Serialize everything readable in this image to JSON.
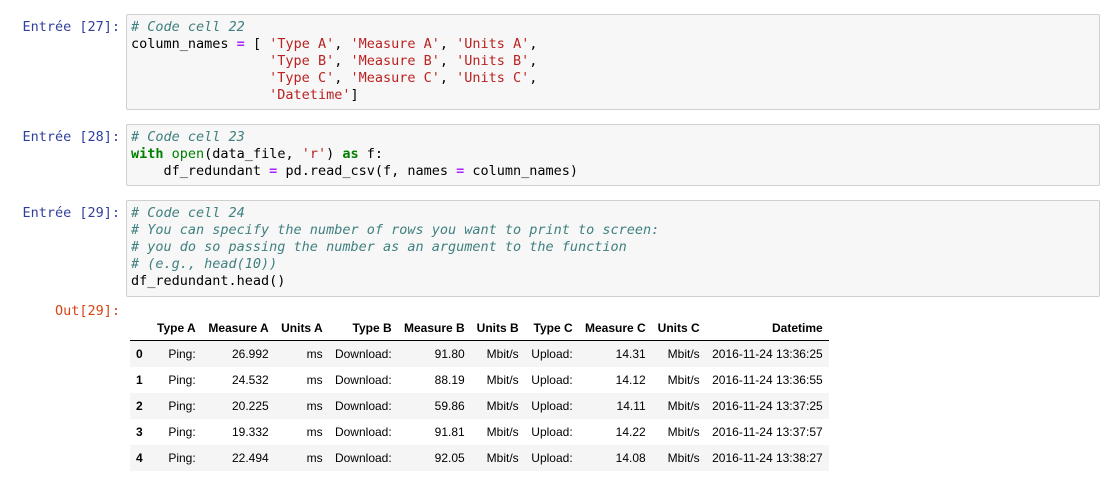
{
  "cells": [
    {
      "prompt": "Entrée [27]:",
      "lines": [
        [
          {
            "t": "# Code cell 22",
            "c": "comment"
          }
        ],
        [
          {
            "t": "column_names ",
            "c": ""
          },
          {
            "t": "=",
            "c": "op"
          },
          {
            "t": " [ ",
            "c": ""
          },
          {
            "t": "'Type A'",
            "c": "str"
          },
          {
            "t": ", ",
            "c": ""
          },
          {
            "t": "'Measure A'",
            "c": "str"
          },
          {
            "t": ", ",
            "c": ""
          },
          {
            "t": "'Units A'",
            "c": "str"
          },
          {
            "t": ",",
            "c": ""
          }
        ],
        [
          {
            "t": "                 ",
            "c": ""
          },
          {
            "t": "'Type B'",
            "c": "str"
          },
          {
            "t": ", ",
            "c": ""
          },
          {
            "t": "'Measure B'",
            "c": "str"
          },
          {
            "t": ", ",
            "c": ""
          },
          {
            "t": "'Units B'",
            "c": "str"
          },
          {
            "t": ",",
            "c": ""
          }
        ],
        [
          {
            "t": "                 ",
            "c": ""
          },
          {
            "t": "'Type C'",
            "c": "str"
          },
          {
            "t": ", ",
            "c": ""
          },
          {
            "t": "'Measure C'",
            "c": "str"
          },
          {
            "t": ", ",
            "c": ""
          },
          {
            "t": "'Units C'",
            "c": "str"
          },
          {
            "t": ",",
            "c": ""
          }
        ],
        [
          {
            "t": "                 ",
            "c": ""
          },
          {
            "t": "'Datetime'",
            "c": "str"
          },
          {
            "t": "]",
            "c": ""
          }
        ]
      ]
    },
    {
      "prompt": "Entrée [28]:",
      "lines": [
        [
          {
            "t": "# Code cell 23",
            "c": "comment"
          }
        ],
        [
          {
            "t": "with",
            "c": "kw"
          },
          {
            "t": " ",
            "c": ""
          },
          {
            "t": "open",
            "c": "bi"
          },
          {
            "t": "(data_file, ",
            "c": ""
          },
          {
            "t": "'r'",
            "c": "str"
          },
          {
            "t": ") ",
            "c": ""
          },
          {
            "t": "as",
            "c": "kw"
          },
          {
            "t": " f:",
            "c": ""
          }
        ],
        [
          {
            "t": "    df_redundant ",
            "c": ""
          },
          {
            "t": "=",
            "c": "op"
          },
          {
            "t": " pd.read_csv(f, names ",
            "c": ""
          },
          {
            "t": "=",
            "c": "op"
          },
          {
            "t": " column_names)",
            "c": ""
          }
        ]
      ]
    },
    {
      "prompt": "Entrée [29]:",
      "lines": [
        [
          {
            "t": "# Code cell 24",
            "c": "comment"
          }
        ],
        [
          {
            "t": "# You can specify the number of rows you want to print to screen:",
            "c": "comment"
          }
        ],
        [
          {
            "t": "# you do so passing the number as an argument to the function",
            "c": "comment"
          }
        ],
        [
          {
            "t": "# (e.g., head(10))",
            "c": "comment"
          }
        ],
        [
          {
            "t": "df_redundant.head()",
            "c": ""
          }
        ]
      ]
    }
  ],
  "output": {
    "prompt": "Out[29]:",
    "columns": [
      "",
      "Type A",
      "Measure A",
      "Units A",
      "Type B",
      "Measure B",
      "Units B",
      "Type C",
      "Measure C",
      "Units C",
      "Datetime"
    ],
    "rows": [
      [
        "0",
        "Ping:",
        "26.992",
        "ms",
        "Download:",
        "91.80",
        "Mbit/s",
        "Upload:",
        "14.31",
        "Mbit/s",
        "2016-11-24 13:36:25"
      ],
      [
        "1",
        "Ping:",
        "24.532",
        "ms",
        "Download:",
        "88.19",
        "Mbit/s",
        "Upload:",
        "14.12",
        "Mbit/s",
        "2016-11-24 13:36:55"
      ],
      [
        "2",
        "Ping:",
        "20.225",
        "ms",
        "Download:",
        "59.86",
        "Mbit/s",
        "Upload:",
        "14.11",
        "Mbit/s",
        "2016-11-24 13:37:25"
      ],
      [
        "3",
        "Ping:",
        "19.332",
        "ms",
        "Download:",
        "91.81",
        "Mbit/s",
        "Upload:",
        "14.22",
        "Mbit/s",
        "2016-11-24 13:37:57"
      ],
      [
        "4",
        "Ping:",
        "22.494",
        "ms",
        "Download:",
        "92.05",
        "Mbit/s",
        "Upload:",
        "14.08",
        "Mbit/s",
        "2016-11-24 13:38:27"
      ]
    ]
  }
}
